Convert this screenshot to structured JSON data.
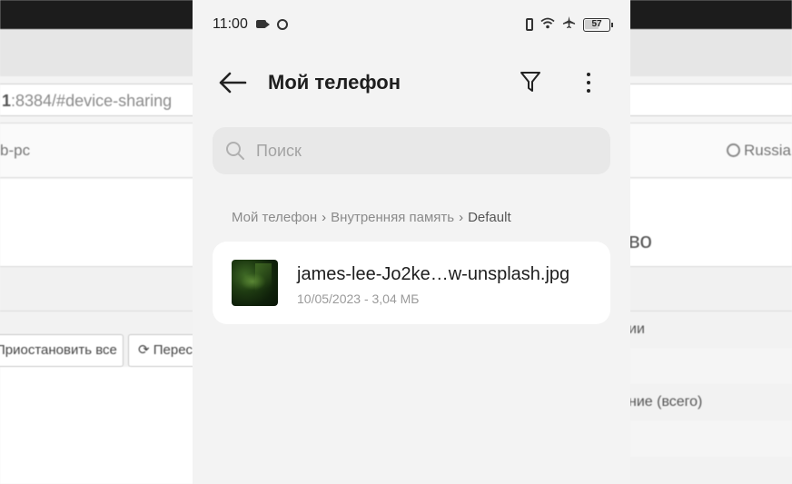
{
  "background_browser": {
    "url_bold": "1",
    "url_rest": ":8384/#device-sharing",
    "hostname": "b-pc",
    "language": "Russia",
    "heading_fragment": "во",
    "buttons": [
      {
        "label": "Приостановить все"
      },
      {
        "label": "Перес"
      }
    ],
    "rows": [
      "ии",
      "",
      "ние (всего)",
      ""
    ]
  },
  "status_bar": {
    "time": "11:00",
    "battery": "57"
  },
  "toolbar": {
    "title": "Мой телефон"
  },
  "search": {
    "placeholder": "Поиск",
    "value": ""
  },
  "breadcrumb": {
    "items": [
      "Мой телефон",
      "Внутренняя память",
      "Default"
    ]
  },
  "files": [
    {
      "name": "james-lee-Jo2ke…w-unsplash.jpg",
      "meta": "10/05/2023 - 3,04 МБ"
    }
  ]
}
